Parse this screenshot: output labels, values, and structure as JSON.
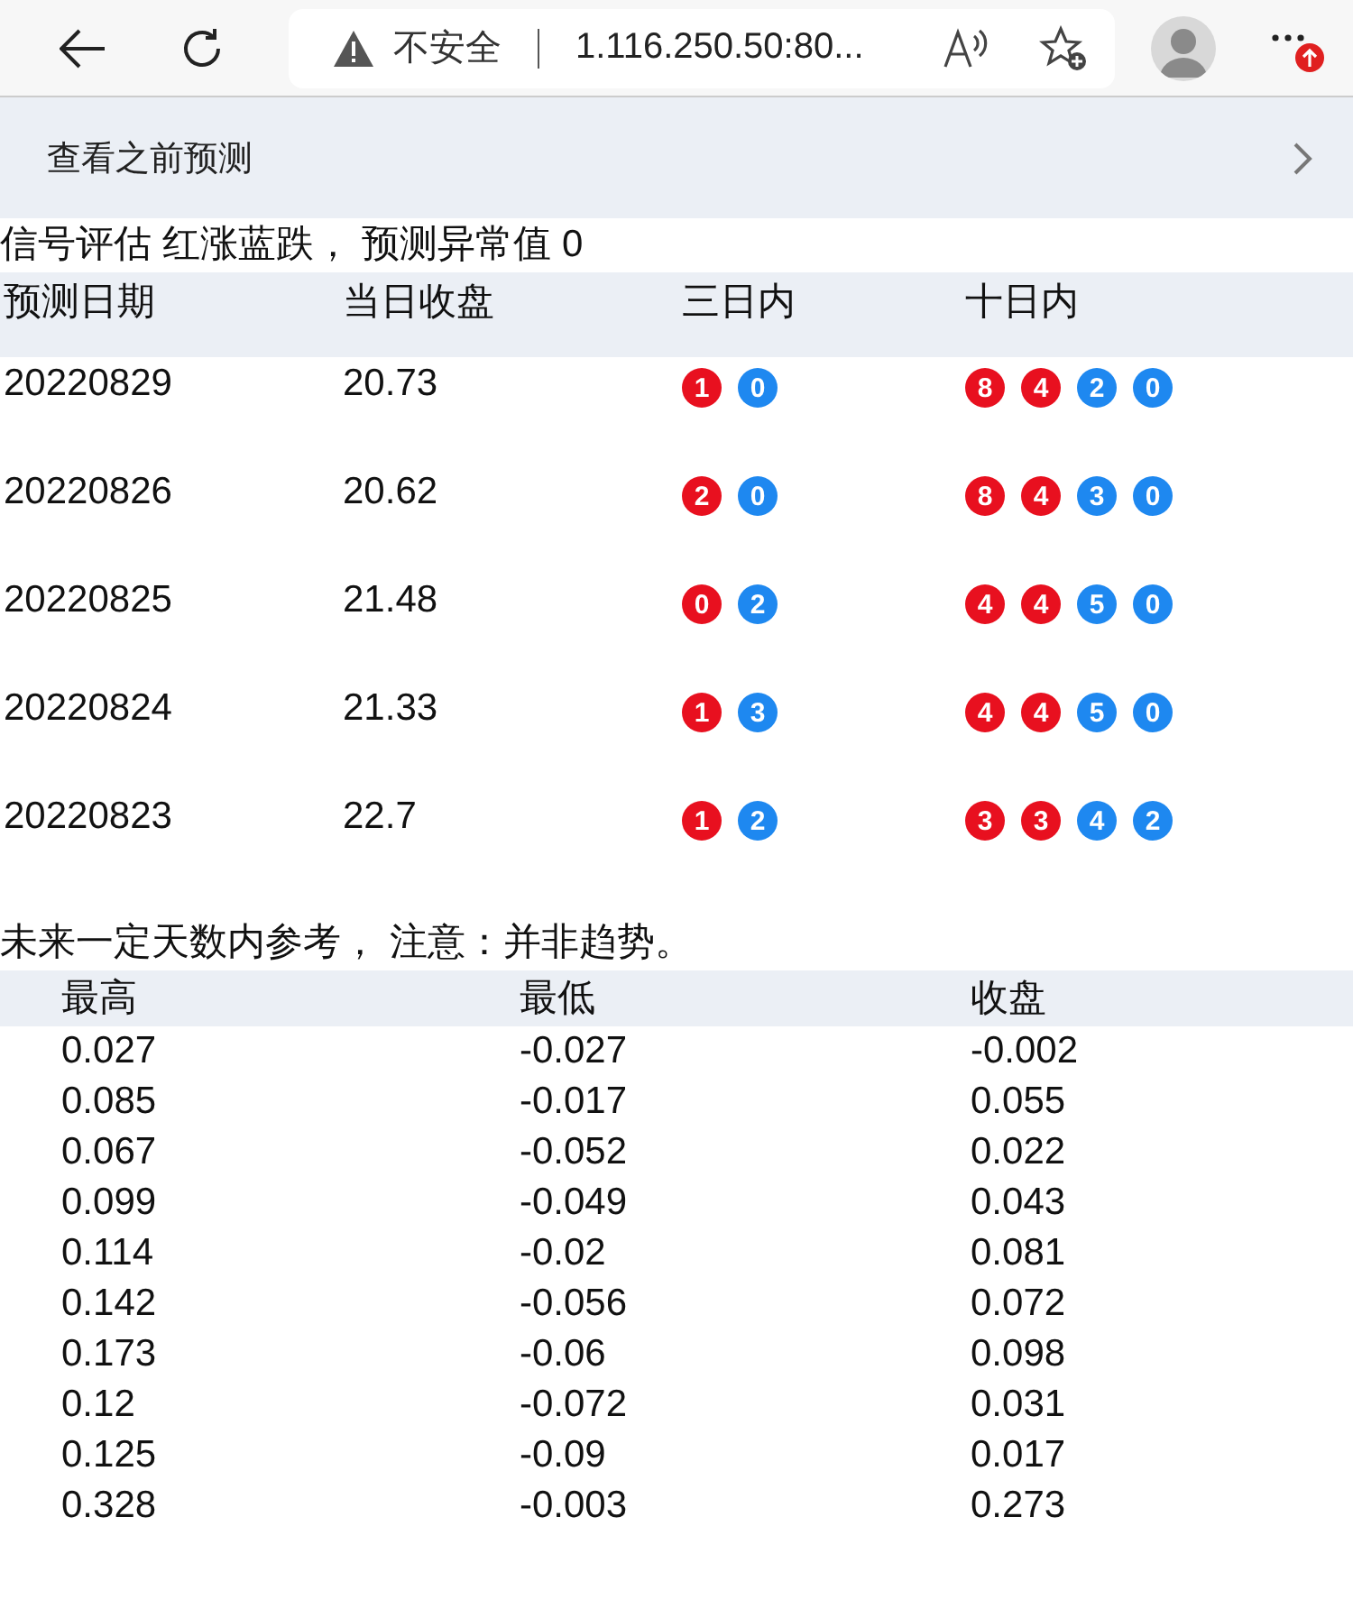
{
  "browser": {
    "security_label": "不安全",
    "url": "1.116.250.50:80..."
  },
  "nav": {
    "label": "查看之前预测"
  },
  "legend": "信号评估 红涨蓝跌， 预测异常值 0",
  "signals": {
    "columns": [
      "预测日期",
      "当日收盘",
      "三日内",
      "十日内"
    ],
    "rows": [
      {
        "date": "20220829",
        "close": "20.73",
        "three_day": [
          {
            "value": "1",
            "color": "#e8101f"
          },
          {
            "value": "0",
            "color": "#1e88f0"
          }
        ],
        "ten_day": [
          {
            "value": "8",
            "color": "#e8101f"
          },
          {
            "value": "4",
            "color": "#e8101f"
          },
          {
            "value": "2",
            "color": "#1e88f0"
          },
          {
            "value": "0",
            "color": "#1e88f0"
          }
        ]
      },
      {
        "date": "20220826",
        "close": "20.62",
        "three_day": [
          {
            "value": "2",
            "color": "#e8101f"
          },
          {
            "value": "0",
            "color": "#1e88f0"
          }
        ],
        "ten_day": [
          {
            "value": "8",
            "color": "#e8101f"
          },
          {
            "value": "4",
            "color": "#e8101f"
          },
          {
            "value": "3",
            "color": "#1e88f0"
          },
          {
            "value": "0",
            "color": "#1e88f0"
          }
        ]
      },
      {
        "date": "20220825",
        "close": "21.48",
        "three_day": [
          {
            "value": "0",
            "color": "#e8101f"
          },
          {
            "value": "2",
            "color": "#1e88f0"
          }
        ],
        "ten_day": [
          {
            "value": "4",
            "color": "#e8101f"
          },
          {
            "value": "4",
            "color": "#e8101f"
          },
          {
            "value": "5",
            "color": "#1e88f0"
          },
          {
            "value": "0",
            "color": "#1e88f0"
          }
        ]
      },
      {
        "date": "20220824",
        "close": "21.33",
        "three_day": [
          {
            "value": "1",
            "color": "#e8101f"
          },
          {
            "value": "3",
            "color": "#1e88f0"
          }
        ],
        "ten_day": [
          {
            "value": "4",
            "color": "#e8101f"
          },
          {
            "value": "4",
            "color": "#e8101f"
          },
          {
            "value": "5",
            "color": "#1e88f0"
          },
          {
            "value": "0",
            "color": "#1e88f0"
          }
        ]
      },
      {
        "date": "20220823",
        "close": "22.7",
        "three_day": [
          {
            "value": "1",
            "color": "#e8101f"
          },
          {
            "value": "2",
            "color": "#1e88f0"
          }
        ],
        "ten_day": [
          {
            "value": "3",
            "color": "#e8101f"
          },
          {
            "value": "3",
            "color": "#e8101f"
          },
          {
            "value": "4",
            "color": "#1e88f0"
          },
          {
            "value": "2",
            "color": "#1e88f0"
          }
        ]
      }
    ]
  },
  "note": "未来一定天数内参考， 注意：并非趋势。",
  "reference": {
    "columns": [
      "最高",
      "最低",
      "收盘"
    ],
    "rows": [
      [
        "0.027",
        "-0.027",
        "-0.002"
      ],
      [
        "0.085",
        "-0.017",
        "0.055"
      ],
      [
        "0.067",
        "-0.052",
        "0.022"
      ],
      [
        "0.099",
        "-0.049",
        "0.043"
      ],
      [
        "0.114",
        "-0.02",
        "0.081"
      ],
      [
        "0.142",
        "-0.056",
        "0.072"
      ],
      [
        "0.173",
        "-0.06",
        "0.098"
      ],
      [
        "0.12",
        "-0.072",
        "0.031"
      ],
      [
        "0.125",
        "-0.09",
        "0.017"
      ],
      [
        "0.328",
        "-0.003",
        "0.273"
      ]
    ]
  }
}
